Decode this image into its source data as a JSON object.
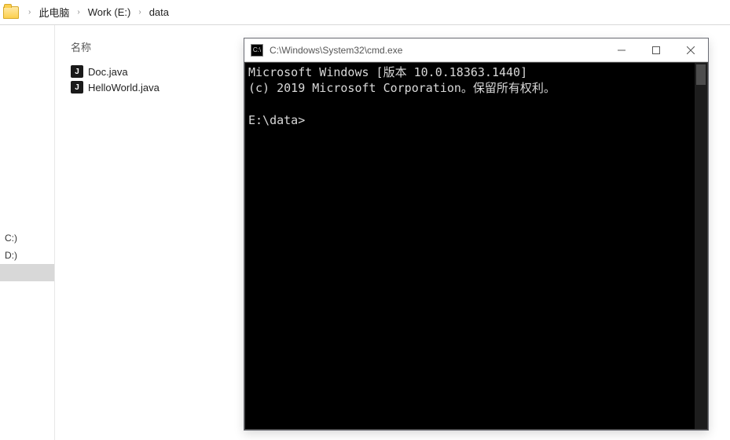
{
  "breadcrumb": {
    "items": [
      {
        "label": "此电脑"
      },
      {
        "label": "Work (E:)"
      },
      {
        "label": "data"
      }
    ]
  },
  "sidebar": {
    "drives": [
      {
        "label": "C:)"
      },
      {
        "label": "D:)"
      }
    ]
  },
  "files": {
    "column_header": "名称",
    "items": [
      {
        "name": "Doc.java"
      },
      {
        "name": "HelloWorld.java"
      }
    ]
  },
  "cmd": {
    "title": "C:\\Windows\\System32\\cmd.exe",
    "line1": "Microsoft Windows [版本 10.0.18363.1440]",
    "line2": "(c) 2019 Microsoft Corporation。保留所有权利。",
    "prompt": "E:\\data>"
  }
}
